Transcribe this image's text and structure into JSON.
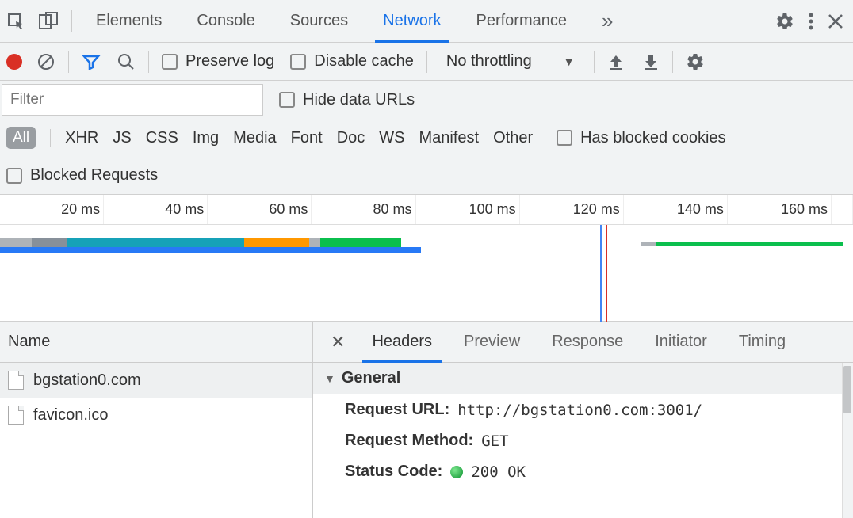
{
  "top_tabs": {
    "elements": "Elements",
    "console": "Console",
    "sources": "Sources",
    "network": "Network",
    "performance": "Performance"
  },
  "toolbar": {
    "preserve_log": "Preserve log",
    "disable_cache": "Disable cache",
    "throttling": "No throttling"
  },
  "filter": {
    "placeholder": "Filter",
    "hide_data_urls": "Hide data URLs"
  },
  "type_filters": {
    "all": "All",
    "xhr": "XHR",
    "js": "JS",
    "css": "CSS",
    "img": "Img",
    "media": "Media",
    "font": "Font",
    "doc": "Doc",
    "ws": "WS",
    "manifest": "Manifest",
    "other": "Other",
    "has_blocked": "Has blocked cookies",
    "blocked_requests": "Blocked Requests"
  },
  "timeline": {
    "ticks": [
      "20 ms",
      "40 ms",
      "60 ms",
      "80 ms",
      "100 ms",
      "120 ms",
      "140 ms",
      "160 ms"
    ]
  },
  "requests": {
    "header": "Name",
    "items": [
      {
        "name": "bgstation0.com"
      },
      {
        "name": "favicon.ico"
      }
    ]
  },
  "detail_tabs": {
    "headers": "Headers",
    "preview": "Preview",
    "response": "Response",
    "initiator": "Initiator",
    "timing": "Timing"
  },
  "headers_section": {
    "general": "General",
    "request_url_k": "Request URL:",
    "request_url_v": "http://bgstation0.com:3001/",
    "request_method_k": "Request Method:",
    "request_method_v": "GET",
    "status_code_k": "Status Code:",
    "status_code_v": "200 OK"
  }
}
